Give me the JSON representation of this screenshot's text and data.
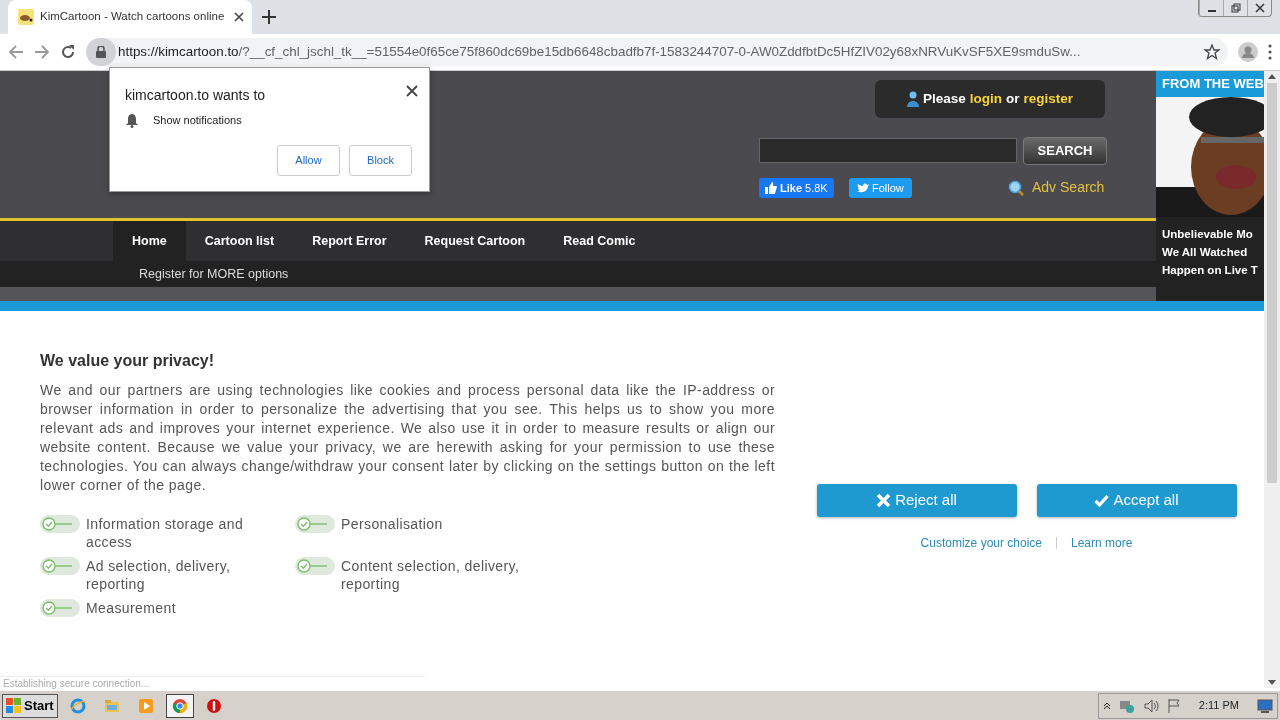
{
  "browser": {
    "tab_title": "KimCartoon - Watch cartoons online",
    "url_host": "https://kimcartoon.to",
    "url_rest": "/?__cf_chl_jschl_tk__=51554e0f65ce75f860dc69be15db6648cbadfb7f-1583244707-0-AW0ZddfbtDc5HfZIV02y68xNRVuKvSF5XE9smduSw..."
  },
  "notification_prompt": {
    "title": "kimcartoon.to wants to",
    "permission": "Show notifications",
    "buttons": [
      "Allow",
      "Block"
    ]
  },
  "site_header": {
    "login_prefix": "Please",
    "login_link": "login",
    "login_or": "or",
    "register_link": "register",
    "search_button": "SEARCH",
    "like_label": "Like",
    "like_count": "5.8K",
    "follow_label": "Follow",
    "adv_search": "Adv Search"
  },
  "nav": {
    "items": [
      {
        "label": "Home",
        "selected": true
      },
      {
        "label": "Cartoon list",
        "selected": false
      },
      {
        "label": "Report Error",
        "selected": false
      },
      {
        "label": "Request Cartoon",
        "selected": false
      },
      {
        "label": "Read Comic",
        "selected": false
      }
    ],
    "sub_nav": "Register for MORE options"
  },
  "ad": {
    "header": "FROM THE WEB",
    "headline": [
      "Unbelievable Mo",
      "We All Watched",
      "Happen on Live T"
    ]
  },
  "privacy": {
    "title": "We value your privacy!",
    "body": "We and our partners are using technologies like cookies and process personal data like the IP-address or browser information in order to personalize the advertising that you see. This helps us to show you more relevant ads and improves your internet experience. We also use it in order to measure results or align our website content. Because we value your privacy, we are herewith asking for your permission to use these technologies. You can always change/withdraw your consent later by clicking on the settings button on the left lower corner of the page.",
    "purposes": [
      {
        "label": "Information storage and access",
        "checked": true
      },
      {
        "label": "Personalisation",
        "checked": true
      },
      {
        "label": "Ad selection, delivery, reporting",
        "checked": true
      },
      {
        "label": "Content selection, delivery, reporting",
        "checked": true
      },
      {
        "label": "Measurement",
        "checked": true
      }
    ],
    "buttons": [
      {
        "label": "Reject all",
        "kind": "reject"
      },
      {
        "label": "Accept all",
        "kind": "accept"
      }
    ],
    "links": [
      "Customize your choice",
      "Learn more"
    ]
  },
  "status_text": "Establishing secure connection...",
  "taskbar": {
    "start": "Start",
    "clock": "2:11 PM",
    "apps": [
      {
        "kind": "ie",
        "active": false
      },
      {
        "kind": "folder",
        "active": false
      },
      {
        "kind": "media",
        "active": false
      },
      {
        "kind": "chrome",
        "active": true
      },
      {
        "kind": "stop",
        "active": false
      }
    ]
  }
}
